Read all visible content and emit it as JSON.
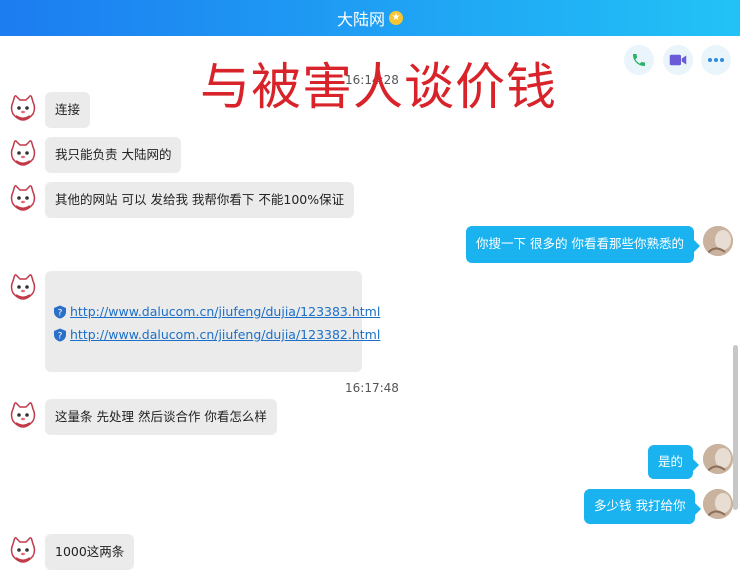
{
  "window": {
    "title": "大陆网",
    "title_badge": "★"
  },
  "toolbar": {
    "call_icon": "phone-icon",
    "video_icon": "video-icon",
    "more_icon": "more-icon"
  },
  "overlay": {
    "caption": "与被害人谈价钱"
  },
  "messages": {
    "time1": "16:14:28",
    "m1": "连接",
    "m2": "我只能负责 大陆网的",
    "m3": "其他的网站 可以 发给我 我帮你看下  不能100%保证",
    "m4": "你搜一下  很多的  你看看那些你熟悉的",
    "link1": "http://www.dalucom.cn/jiufeng/dujia/123383.html",
    "link2": "http://www.dalucom.cn/jiufeng/dujia/123382.html",
    "time2": "16:17:48",
    "m5": "这量条  先处理 然后谈合作 你看怎么样",
    "m6": "是的",
    "m7": "多少钱 我打给你",
    "m8": "1000这两条"
  },
  "colors": {
    "accent": "#1ab3f0",
    "title_gradient_start": "#1c7cf1",
    "title_gradient_end": "#22c2f6",
    "overlay_text": "#d8232a"
  }
}
